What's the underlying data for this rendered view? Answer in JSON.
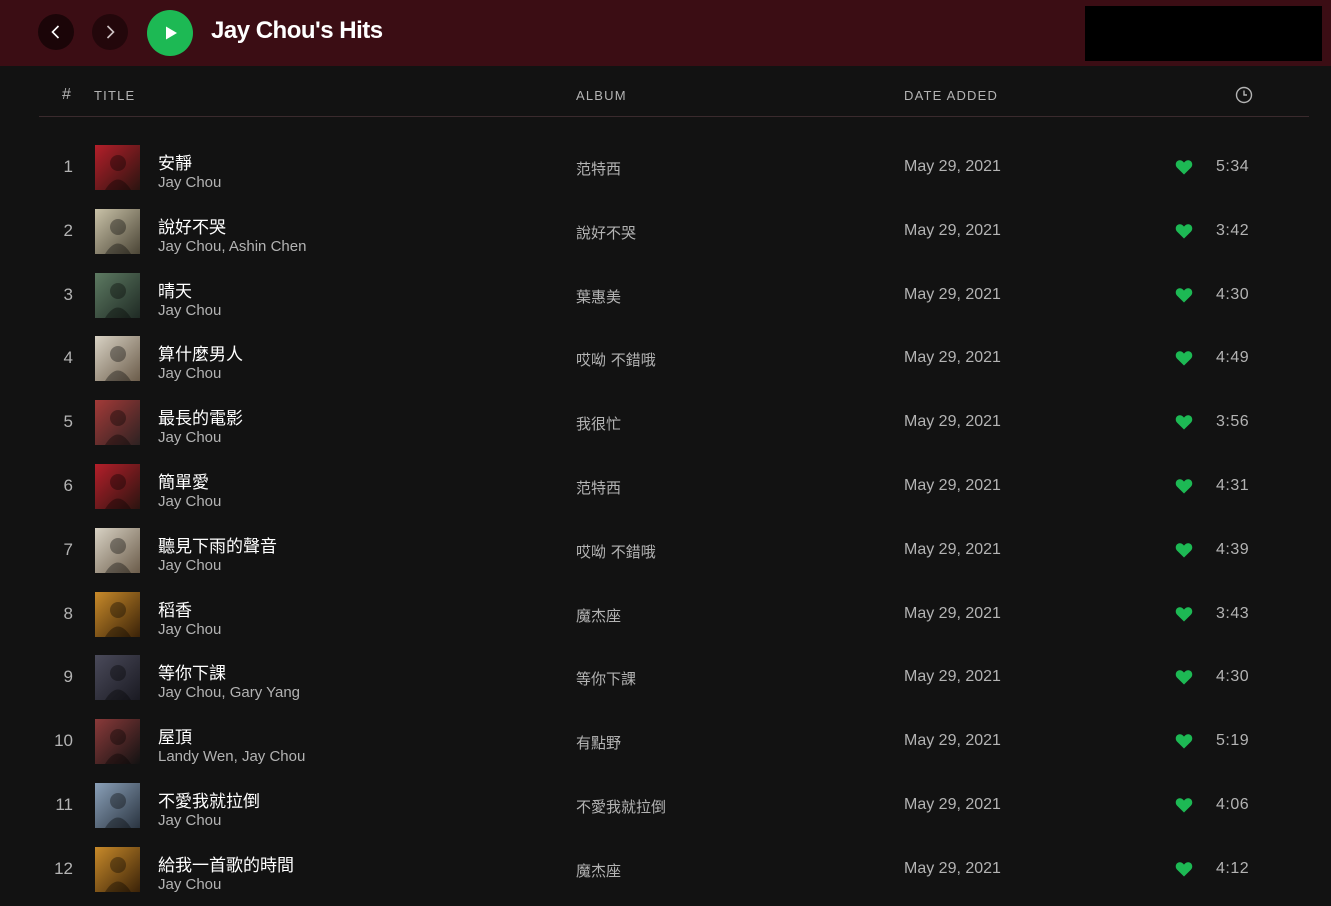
{
  "header": {
    "title": "Jay Chou's Hits",
    "accent_color": "#1db954",
    "topbar_color": "#3b0d14",
    "icons": {
      "back": "chevron-left-icon",
      "forward": "chevron-right-icon",
      "play": "play-icon"
    }
  },
  "columns": {
    "num": "#",
    "title": "TITLE",
    "album": "ALBUM",
    "date_added": "DATE ADDED",
    "duration_icon": "clock-icon"
  },
  "tracks": [
    {
      "num": "1",
      "title": "安靜",
      "artist": "Jay Chou",
      "album": "范特西",
      "date": "May 29, 2021",
      "duration": "5:34",
      "cover": [
        "#b41f2a",
        "#2a1410"
      ]
    },
    {
      "num": "2",
      "title": "說好不哭",
      "artist": "Jay Chou, Ashin Chen",
      "album": "說好不哭",
      "date": "May 29, 2021",
      "duration": "3:42",
      "cover": [
        "#c9c2a8",
        "#4b4536"
      ]
    },
    {
      "num": "3",
      "title": "晴天",
      "artist": "Jay Chou",
      "album": "葉惠美",
      "date": "May 29, 2021",
      "duration": "4:30",
      "cover": [
        "#5d7a62",
        "#1f2a24"
      ]
    },
    {
      "num": "4",
      "title": "算什麼男人",
      "artist": "Jay Chou",
      "album": "哎呦 不錯哦",
      "date": "May 29, 2021",
      "duration": "4:49",
      "cover": [
        "#d8d2c4",
        "#6b5c4a"
      ]
    },
    {
      "num": "5",
      "title": "最長的電影",
      "artist": "Jay Chou",
      "album": "我很忙",
      "date": "May 29, 2021",
      "duration": "3:56",
      "cover": [
        "#a33a38",
        "#2d2222"
      ]
    },
    {
      "num": "6",
      "title": "簡單愛",
      "artist": "Jay Chou",
      "album": "范特西",
      "date": "May 29, 2021",
      "duration": "4:31",
      "cover": [
        "#b41f2a",
        "#2a1410"
      ]
    },
    {
      "num": "7",
      "title": "聽見下雨的聲音",
      "artist": "Jay Chou",
      "album": "哎呦 不錯哦",
      "date": "May 29, 2021",
      "duration": "4:39",
      "cover": [
        "#d8d2c4",
        "#6b5c4a"
      ]
    },
    {
      "num": "8",
      "title": "稻香",
      "artist": "Jay Chou",
      "album": "魔杰座",
      "date": "May 29, 2021",
      "duration": "3:43",
      "cover": [
        "#c88a2a",
        "#3a2208"
      ]
    },
    {
      "num": "9",
      "title": "等你下課",
      "artist": "Jay Chou, Gary Yang",
      "album": "等你下課",
      "date": "May 29, 2021",
      "duration": "4:30",
      "cover": [
        "#4a4a5a",
        "#1a1a22"
      ]
    },
    {
      "num": "10",
      "title": "屋頂",
      "artist": "Landy Wen, Jay Chou",
      "album": "有點野",
      "date": "May 29, 2021",
      "duration": "5:19",
      "cover": [
        "#8a3a3a",
        "#121212"
      ]
    },
    {
      "num": "11",
      "title": "不愛我就拉倒",
      "artist": "Jay Chou",
      "album": "不愛我就拉倒",
      "date": "May 29, 2021",
      "duration": "4:06",
      "cover": [
        "#8aa0b8",
        "#2a3440"
      ]
    },
    {
      "num": "12",
      "title": "給我一首歌的時間",
      "artist": "Jay Chou",
      "album": "魔杰座",
      "date": "May 29, 2021",
      "duration": "4:12",
      "cover": [
        "#c88a2a",
        "#3a2208"
      ]
    }
  ]
}
